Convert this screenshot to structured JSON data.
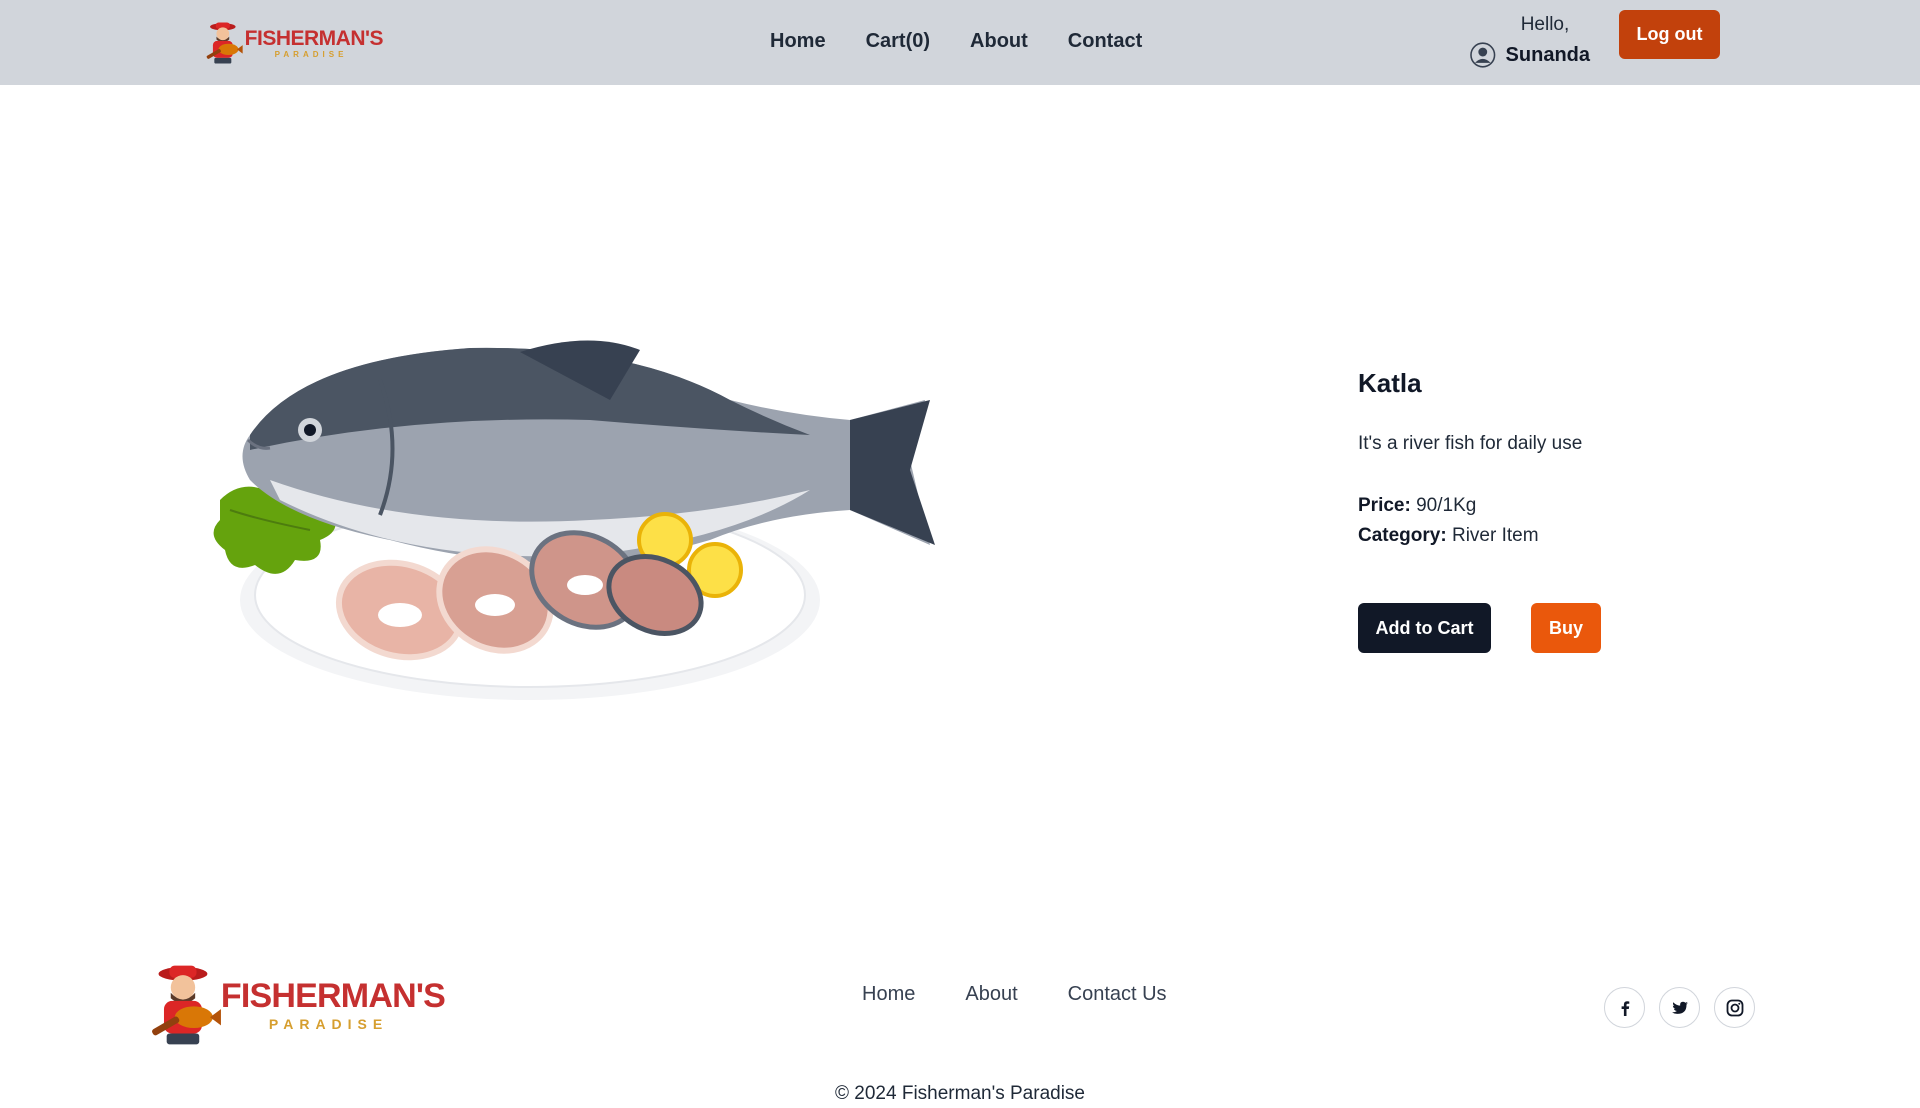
{
  "brand": {
    "logo_title": "FISHERMAN'S",
    "logo_sub": "PARADISE"
  },
  "header": {
    "nav": {
      "home": "Home",
      "cart": "Cart(0)",
      "about": "About",
      "contact": "Contact"
    },
    "greeting": "Hello,",
    "username": "Sunanda",
    "logout_label": "Log out"
  },
  "product": {
    "name": "Katla",
    "description": "It's a river fish for daily use",
    "price_label": "Price:",
    "price_value": "90/1Kg",
    "category_label": "Category:",
    "category_value": "River Item",
    "add_to_cart_label": "Add to Cart",
    "buy_label": "Buy"
  },
  "footer": {
    "nav": {
      "home": "Home",
      "about": "About",
      "contact": "Contact Us"
    },
    "socials": [
      "facebook-icon",
      "twitter-icon",
      "instagram-icon"
    ],
    "copyright": "© 2024 Fisherman's Paradise"
  },
  "colors": {
    "header_bg": "#d1d5db",
    "logout_bg": "#c2410c",
    "cart_btn_bg": "#111827",
    "buy_btn_bg": "#ea580c",
    "brand_red": "#c53030",
    "brand_gold": "#d69e2e"
  }
}
